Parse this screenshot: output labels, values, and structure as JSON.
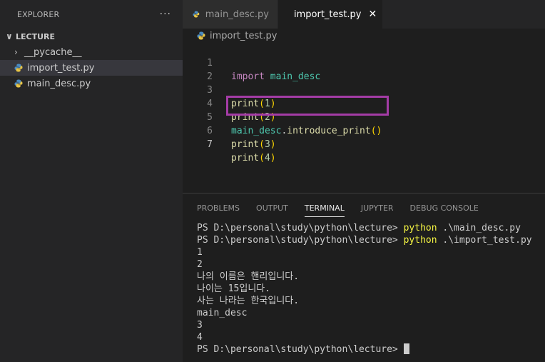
{
  "sidebar": {
    "title": "EXPLORER",
    "more_label": "···",
    "folder": "LECTURE",
    "items": [
      {
        "label": "__pycache__",
        "type": "folder"
      },
      {
        "label": "import_test.py",
        "type": "python-file",
        "selected": true
      },
      {
        "label": "main_desc.py",
        "type": "python-file"
      }
    ]
  },
  "tabs": [
    {
      "label": "main_desc.py",
      "active": false
    },
    {
      "label": "import_test.py",
      "active": true,
      "close": "✕"
    }
  ],
  "breadcrumb": "import_test.py",
  "editor": {
    "line_numbers": [
      "1",
      "2",
      "3",
      "4",
      "5",
      "6",
      "7"
    ],
    "active_line": "7",
    "line1": {
      "kw": "import",
      "mod": "main_desc"
    },
    "line3": {
      "fn": "print",
      "open": "(",
      "arg": "1",
      "close": ")"
    },
    "line4": {
      "fn": "print",
      "open": "(",
      "arg": "2",
      "close": ")"
    },
    "line5": {
      "mod": "main_desc",
      "dot": ".",
      "fn": "introduce_print",
      "parens": "()"
    },
    "line6": {
      "fn": "print",
      "open": "(",
      "arg": "3",
      "close": ")"
    },
    "line7": {
      "fn": "print",
      "open": "(",
      "arg": "4",
      "close": ")"
    },
    "highlight_color": "#a43ca6"
  },
  "panel": {
    "tabs": [
      "PROBLEMS",
      "OUTPUT",
      "TERMINAL",
      "JUPYTER",
      "DEBUG CONSOLE"
    ],
    "active_tab": "TERMINAL"
  },
  "terminal": {
    "prompt": "PS D:\\personal\\study\\python\\lecture> ",
    "cmd1_word": "python",
    "cmd1_arg": " .\\main_desc.py",
    "cmd2_word": "python",
    "cmd2_arg": " .\\import_test.py",
    "output": [
      "1",
      "2",
      "나의 이름은 핸리입니다.",
      "나이는 15입니다.",
      "사는 나라는 한국입니다.",
      "main_desc",
      "3",
      "4"
    ]
  },
  "colors": {
    "keyword": "#c586c0",
    "module": "#4ec9b0",
    "function": "#dcdcaa",
    "bracket": "#ffd700",
    "number": "#b5cea8",
    "command": "#f5f543"
  }
}
